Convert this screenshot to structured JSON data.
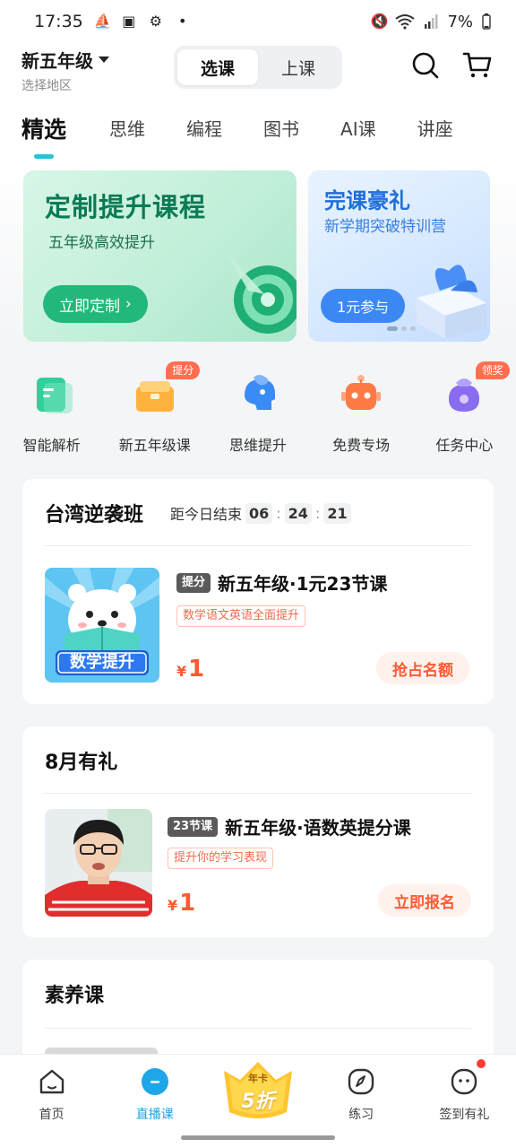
{
  "status_bar": {
    "time": "17:35",
    "battery": "7%"
  },
  "header": {
    "grade": "新五年级",
    "region": "选择地区",
    "modes": [
      "选课",
      "上课"
    ]
  },
  "tabs": [
    "精选",
    "思维",
    "编程",
    "图书",
    "AI课",
    "讲座"
  ],
  "banners": {
    "main": {
      "title": "定制提升课程",
      "subtitle": "五年级高效提升",
      "button": "立即定制"
    },
    "side": {
      "title": "完课豪礼",
      "subtitle": "新学期突破特训营",
      "button": "1元参与"
    }
  },
  "quick_entries": [
    {
      "label": "智能解析",
      "badge": "",
      "color": "#2fd19a",
      "icon": "analysis-icon"
    },
    {
      "label": "新五年级课",
      "badge": "提分",
      "color": "#ffb23e",
      "icon": "course-box-icon"
    },
    {
      "label": "思维提升",
      "badge": "",
      "color": "#3a8bf5",
      "icon": "brain-head-icon"
    },
    {
      "label": "免费专场",
      "badge": "",
      "color": "#ff7a45",
      "icon": "robot-icon"
    },
    {
      "label": "任务中心",
      "badge": "领奖",
      "color": "#8a6cf0",
      "icon": "bag-icon"
    }
  ],
  "section_1": {
    "title": "台湾逆袭班",
    "countdown_label": "距今日结束",
    "countdown": [
      "06",
      "24",
      "21"
    ],
    "course": {
      "thumb_label": "数学提升",
      "tag": "提分",
      "title": "新五年级·1元23节课",
      "desc": "数学语文英语全面提升",
      "currency": "¥",
      "price": "1",
      "cta": "抢占名额"
    }
  },
  "section_2": {
    "title": "8月有礼",
    "course": {
      "tag": "23节课",
      "title": "新五年级·语数英提分课",
      "desc": "提升你的学习表现",
      "currency": "¥",
      "price": "1",
      "cta": "立即报名"
    }
  },
  "section_3": {
    "title": "素养课"
  },
  "bottom_nav": {
    "items": [
      {
        "label": "首页",
        "icon": "home-icon"
      },
      {
        "label": "直播课",
        "icon": "live-icon"
      },
      {
        "label": "练习",
        "icon": "compass-icon"
      },
      {
        "label": "签到有礼",
        "icon": "smile-icon"
      }
    ],
    "promo": {
      "top": "年卡",
      "main": "5折"
    }
  },
  "colors": {
    "accent": "#1ea6e8",
    "price": "#ff5a33",
    "tab_indicator": "#21c4d8"
  }
}
